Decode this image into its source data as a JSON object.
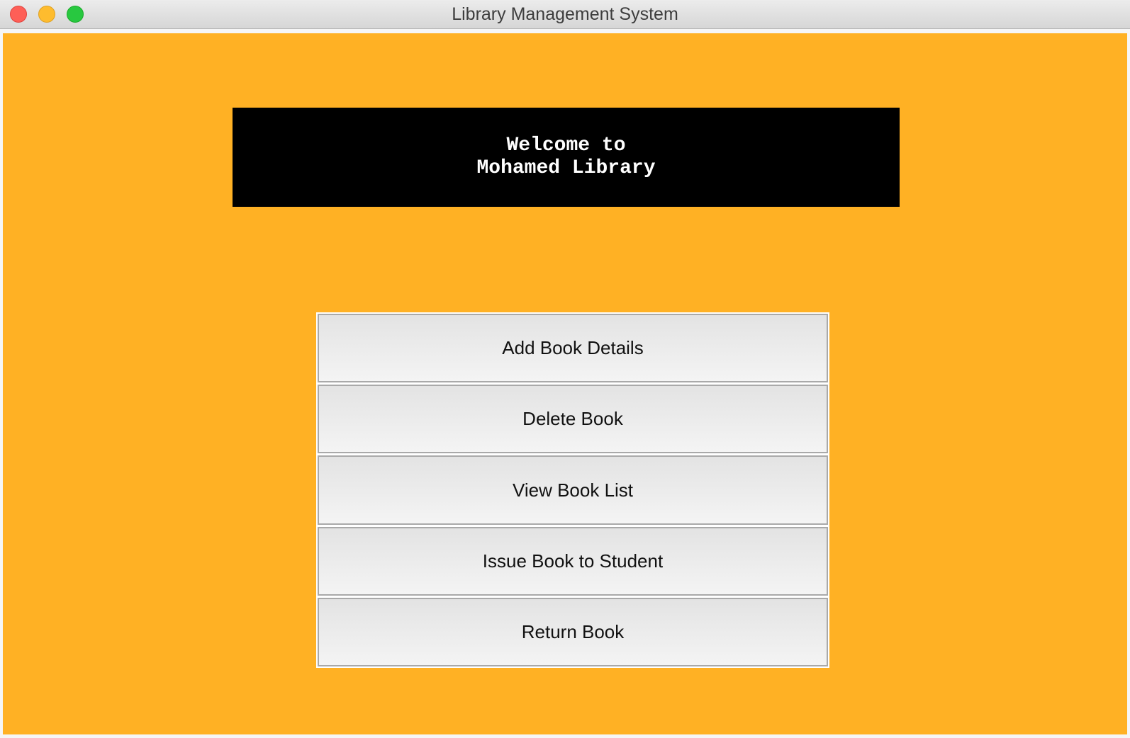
{
  "window": {
    "title": "Library Management System"
  },
  "heading": {
    "text": "Welcome to\nMohamed Library"
  },
  "menu": {
    "buttons": [
      {
        "label": "Add Book Details"
      },
      {
        "label": "Delete Book"
      },
      {
        "label": "View Book List"
      },
      {
        "label": "Issue Book to Student"
      },
      {
        "label": "Return Book"
      }
    ]
  },
  "colors": {
    "background": "#ffb124",
    "heading_panel": "#000000",
    "heading_text": "#ffffff"
  }
}
